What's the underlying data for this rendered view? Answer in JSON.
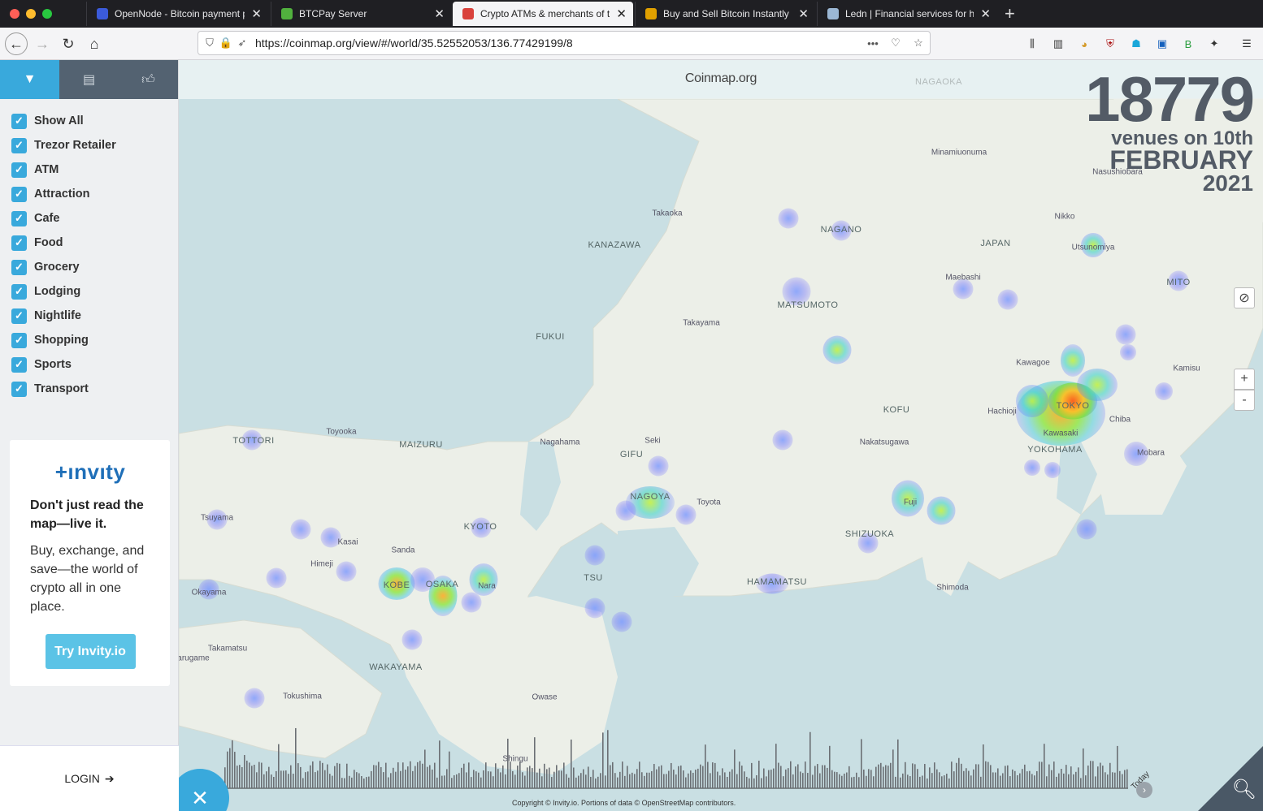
{
  "browser": {
    "tabs": [
      {
        "title": "OpenNode - Bitcoin payment pr",
        "active": false,
        "favicon_color": "#3b5bdb"
      },
      {
        "title": "BTCPay Server",
        "active": false,
        "favicon_color": "#51b13e"
      },
      {
        "title": "Crypto ATMs & merchants of th",
        "active": true,
        "favicon_color": "#d9413b"
      },
      {
        "title": "Buy and Sell Bitcoin Instantly | E",
        "active": false,
        "favicon_color": "#e0a000"
      },
      {
        "title": "Ledn | Financial services for ho",
        "active": false,
        "favicon_color": "#9bb7d4"
      }
    ],
    "url": "https://coinmap.org/view/#/world/35.52552053/136.77429199/8",
    "toolbar_icons": [
      "library-icon",
      "sidebar-icon",
      "extension-icon",
      "ublock-icon",
      "ghost-icon",
      "container-icon",
      "bplus-icon",
      "puzzle-icon",
      "menu-icon"
    ]
  },
  "sidebar": {
    "tabs": [
      "filter-icon",
      "building-icon",
      "thumbs-up-icon"
    ],
    "filters": [
      "Show All",
      "Trezor Retailer",
      "ATM",
      "Attraction",
      "Cafe",
      "Food",
      "Grocery",
      "Lodging",
      "Nightlife",
      "Shopping",
      "Sports",
      "Transport"
    ],
    "promo": {
      "logo": "+ınvıty",
      "headline": "Don't just read the map—live it.",
      "body": "Buy, exchange, and save—the world of crypto all in one place.",
      "button": "Try Invity.io"
    },
    "login": "LOGIN"
  },
  "map": {
    "header": "Coinmap.org",
    "counter": {
      "number": "18779",
      "line1": "venues on 10th",
      "line2": "FEBRUARY",
      "line3": "2021"
    },
    "controls": {
      "zoom_in": "+",
      "zoom_out": "-"
    },
    "places": [
      {
        "name": "NAGAOKA",
        "major": true
      },
      {
        "name": "Minamiuonuma",
        "major": false
      },
      {
        "name": "Nasushiobara",
        "major": false
      },
      {
        "name": "Takaoka",
        "major": false
      },
      {
        "name": "KANAZAWA",
        "major": true
      },
      {
        "name": "NAGANO",
        "major": true
      },
      {
        "name": "Nikko",
        "major": false
      },
      {
        "name": "JAPAN",
        "major": true
      },
      {
        "name": "Utsunomiya",
        "major": false
      },
      {
        "name": "Maebashi",
        "major": false
      },
      {
        "name": "MITO",
        "major": true
      },
      {
        "name": "MATSUMOTO",
        "major": true
      },
      {
        "name": "Takayama",
        "major": false
      },
      {
        "name": "FUKUI",
        "major": true
      },
      {
        "name": "Kawagoe",
        "major": false
      },
      {
        "name": "Kamisu",
        "major": false
      },
      {
        "name": "KOFU",
        "major": true
      },
      {
        "name": "Hachioji",
        "major": false
      },
      {
        "name": "TOKYO",
        "major": true
      },
      {
        "name": "Kawasaki",
        "major": false
      },
      {
        "name": "Chiba",
        "major": false
      },
      {
        "name": "YOKOHAMA",
        "major": true
      },
      {
        "name": "TOTTORI",
        "major": true
      },
      {
        "name": "Toyooka",
        "major": false
      },
      {
        "name": "MAIZURU",
        "major": true
      },
      {
        "name": "Nagahama",
        "major": false
      },
      {
        "name": "Seki",
        "major": false
      },
      {
        "name": "GIFU",
        "major": true
      },
      {
        "name": "Nakatsugawa",
        "major": false
      },
      {
        "name": "Mobara",
        "major": false
      },
      {
        "name": "NAGOYA",
        "major": true
      },
      {
        "name": "Toyota",
        "major": false
      },
      {
        "name": "Fuji",
        "major": false
      },
      {
        "name": "Tsuyama",
        "major": false
      },
      {
        "name": "Kasai",
        "major": false
      },
      {
        "name": "KYOTO",
        "major": true
      },
      {
        "name": "SHIZUOKA",
        "major": true
      },
      {
        "name": "Sanda",
        "major": false
      },
      {
        "name": "Himeji",
        "major": false
      },
      {
        "name": "TSU",
        "major": true
      },
      {
        "name": "KOBE",
        "major": true
      },
      {
        "name": "OSAKA",
        "major": true
      },
      {
        "name": "Nara",
        "major": false
      },
      {
        "name": "HAMAMATSU",
        "major": true
      },
      {
        "name": "Shimoda",
        "major": false
      },
      {
        "name": "Okayama",
        "major": false
      },
      {
        "name": "Takamatsu",
        "major": false
      },
      {
        "name": "arugame",
        "major": false
      },
      {
        "name": "WAKAYAMA",
        "major": true
      },
      {
        "name": "Tokushima",
        "major": false
      },
      {
        "name": "Owase",
        "major": false
      },
      {
        "name": "Shingu",
        "major": false
      }
    ],
    "timeline": {
      "today_label": "Today"
    },
    "copyright": "Copyright © Invity.io. Portions of data © OpenStreetMap contributors."
  }
}
